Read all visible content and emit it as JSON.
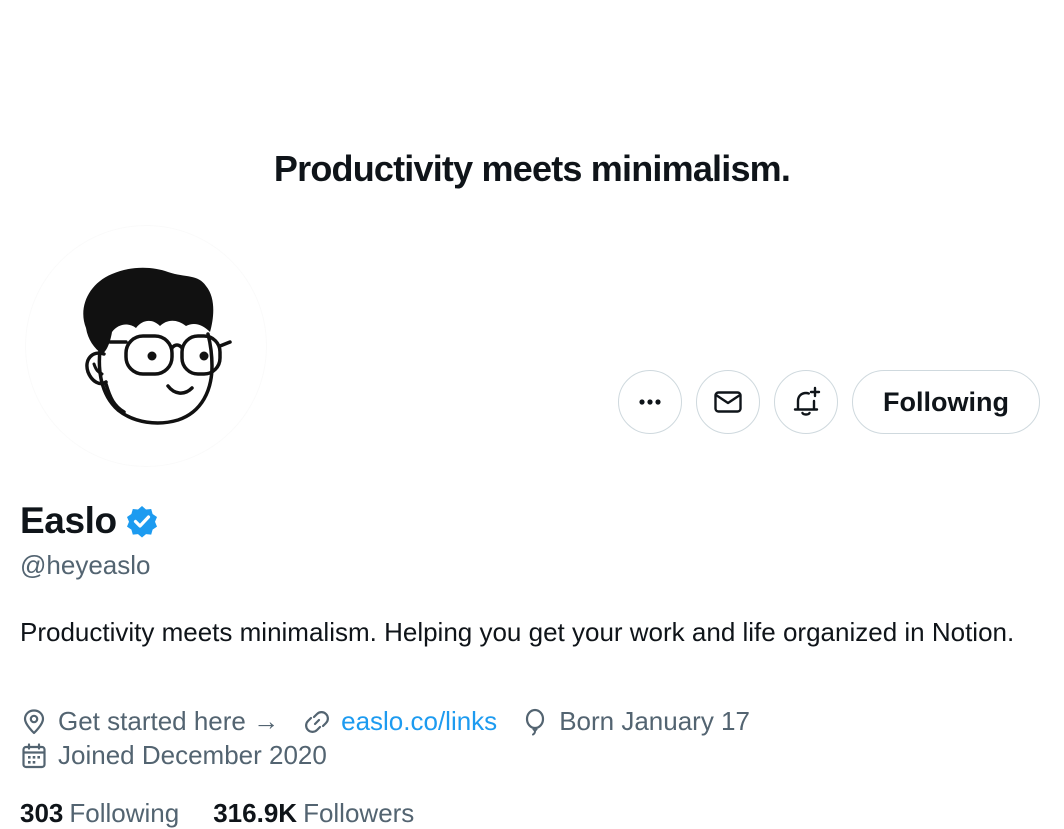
{
  "banner": {
    "tagline": "Productivity meets minimalism."
  },
  "profile": {
    "display_name": "Easlo",
    "handle": "@heyeaslo",
    "bio": "Productivity meets minimalism. Helping you get your work and life organized in Notion.",
    "verified": true
  },
  "actions": {
    "more_icon": "ellipsis-icon",
    "message_icon": "mail-icon",
    "notify_icon": "bell-plus-icon",
    "follow_label": "Following"
  },
  "meta": {
    "location": "Get started here →",
    "website": "easlo.co/links",
    "birthday": "Born January 17",
    "joined": "Joined December 2020"
  },
  "stats": {
    "following_count": "303",
    "following_label": "Following",
    "followers_count": "316.9K",
    "followers_label": "Followers"
  },
  "colors": {
    "accent": "#1d9bf0",
    "secondary_text": "#536471",
    "border": "#cfd9de",
    "verified_badge": "#1d9bf0"
  }
}
